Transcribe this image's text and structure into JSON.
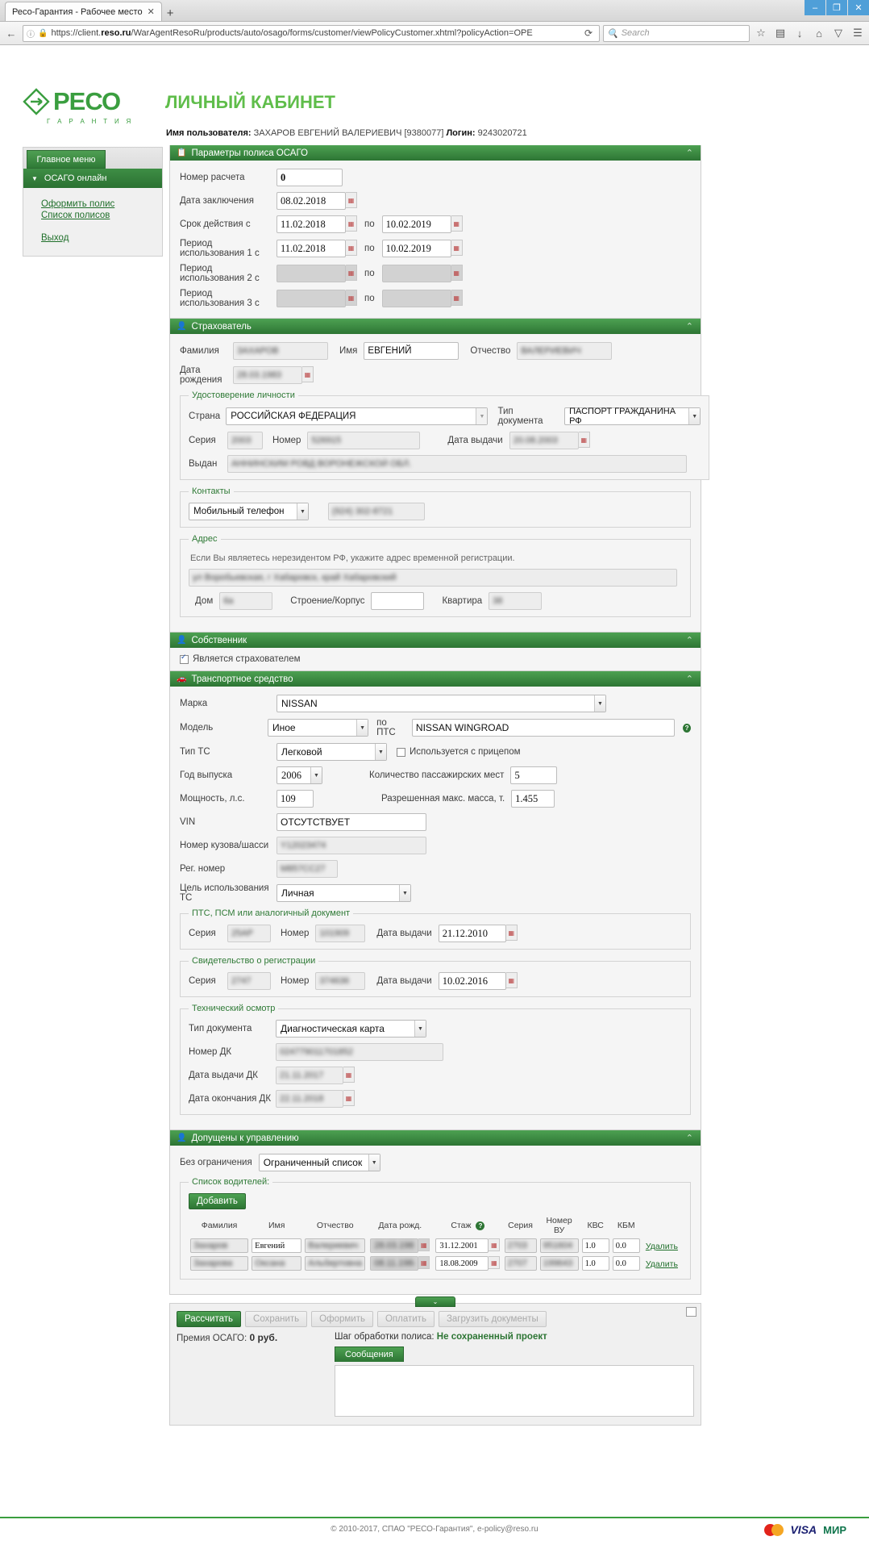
{
  "browser": {
    "tab_title": "Ресо-Гарантия - Рабочее место",
    "tab_close": "✕",
    "new_tab": "+",
    "window_minimize": "–",
    "window_maximize": "❐",
    "window_close": "✕",
    "url_prefix": "https://client.",
    "url_host": "reso.ru",
    "url_path": "/WarAgentResoRu/products/auto/osago/forms/customer/viewPolicyCustomer.xhtml?policyAction=OPE",
    "reload": "⟳",
    "search_placeholder": "Search",
    "back": "←",
    "forward": "→",
    "bookmark": "☆",
    "reader": "▤",
    "download": "↓",
    "home": "⌂",
    "shield": "▽",
    "menu": "☰"
  },
  "brand": {
    "word": "РЕСО",
    "tagline": "Г А Р А Н Т И Я"
  },
  "header": {
    "title": "ЛИЧНЫЙ КАБИНЕТ",
    "user_label": "Имя пользователя:",
    "user_name": "ЗАХАРОВ ЕВГЕНИЙ ВАЛЕРИЕВИЧ [9380077]",
    "login_label": "Логин:",
    "login_value": "9243020721"
  },
  "sidebar": {
    "main_menu_button": "Главное меню",
    "section_label": "ОСАГО онлайн",
    "links": [
      "Оформить полис",
      "Список полисов"
    ],
    "logout": "Выход"
  },
  "policy_params": {
    "title": "Параметры полиса ОСАГО",
    "calc_number_label": "Номер расчета",
    "calc_number_value": "0",
    "conclusion_date_label": "Дата заключения",
    "conclusion_date_value": "08.02.2018",
    "validity_label": "Срок действия с",
    "validity_from": "11.02.2018",
    "to_label": "по",
    "validity_to": "10.02.2019",
    "period1_label": "Период использования 1 с",
    "period1_from": "11.02.2018",
    "period1_to": "10.02.2019",
    "period2_label": "Период использования 2 с",
    "period2_from": "",
    "period2_to": "",
    "period3_label": "Период использования 3 с",
    "period3_from": "",
    "period3_to": ""
  },
  "insurer": {
    "title": "Страхователь",
    "surname_label": "Фамилия",
    "surname_value": "ЗАХАРОВ",
    "name_label": "Имя",
    "name_value": "ЕВГЕНИЙ",
    "patronymic_label": "Отчество",
    "patronymic_value": "ВАЛЕРИЕВИЧ",
    "birthdate_label": "Дата рождения",
    "birthdate_value": "28.03.1983",
    "id_doc": {
      "legend": "Удостоверение личности",
      "country_label": "Страна",
      "country_value": "РОССИЙСКАЯ ФЕДЕРАЦИЯ",
      "doctype_label": "Тип документа",
      "doctype_value": "ПАСПОРТ ГРАЖДАНИНА РФ",
      "series_label": "Серия",
      "series_value": "2003",
      "number_label": "Номер",
      "number_value": "526915",
      "issue_date_label": "Дата выдачи",
      "issue_date_value": "20.08.2003",
      "issued_by_label": "Выдан",
      "issued_by_value": "АННИНСКИМ РОВД ВОРОНЕЖСКОЙ ОБЛ."
    },
    "contacts": {
      "legend": "Контакты",
      "type_value": "Мобильный телефон",
      "phone_value": "(924) 302-8721"
    },
    "address": {
      "legend": "Адрес",
      "hint": "Если Вы являетесь нерезидентом РФ, укажите адрес временной регистрации.",
      "address_value": "ул Воробьевская, г Хабаровск, край Хабаровский",
      "house_label": "Дом",
      "house_value": "6а",
      "building_label": "Строение/Корпус",
      "building_value": "",
      "flat_label": "Квартира",
      "flat_value": "38"
    }
  },
  "owner": {
    "title": "Собственник",
    "same_as_insurer_label": "Является страхователем",
    "same_as_insurer_checked": true
  },
  "vehicle": {
    "title": "Транспортное средство",
    "brand_label": "Марка",
    "brand_value": "NISSAN",
    "model_label": "Модель",
    "model_value": "Иное",
    "pts_model_label": "по ПТС",
    "pts_model_value": "NISSAN WINGROAD",
    "type_label": "Тип ТС",
    "type_value": "Легковой",
    "trailer_label": "Используется с прицепом",
    "trailer_checked": false,
    "year_label": "Год выпуска",
    "year_value": "2006",
    "seats_label": "Количество пассажирских мест",
    "seats_value": "5",
    "power_label": "Мощность, л.с.",
    "power_value": "109",
    "max_mass_label": "Разрешенная макс. масса, т.",
    "max_mass_value": "1.455",
    "vin_label": "VIN",
    "vin_value": "ОТСУТСТВУЕТ",
    "body_label": "Номер кузова/шасси",
    "body_value": "Y12023474",
    "reg_label": "Рег. номер",
    "reg_value": "М857СС27",
    "purpose_label": "Цель использования ТС",
    "purpose_value": "Личная",
    "pts": {
      "legend": "ПТС, ПСМ или аналогичный документ",
      "series_label": "Серия",
      "series_value": "25АР",
      "number_label": "Номер",
      "number_value": "101909",
      "date_label": "Дата выдачи",
      "date_value": "21.12.2010"
    },
    "sts": {
      "legend": "Свидетельство о регистрации",
      "series_label": "Серия",
      "series_value": "2747",
      "number_label": "Номер",
      "number_value": "374636",
      "date_label": "Дата выдачи",
      "date_value": "10.02.2016"
    },
    "inspection": {
      "legend": "Технический осмотр",
      "doctype_label": "Тип документа",
      "doctype_value": "Диагностическая карта",
      "dk_number_label": "Номер ДК",
      "dk_number_value": "024779011701852",
      "dk_issue_label": "Дата выдачи ДК",
      "dk_issue_value": "21.11.2017",
      "dk_expire_label": "Дата окончания ДК",
      "dk_expire_value": "22.11.2018"
    }
  },
  "drivers": {
    "title": "Допущены к управлению",
    "restriction_label": "Без ограничения",
    "restriction_value": "Ограниченный список",
    "list_legend": "Список водителей:",
    "add_button": "Добавить",
    "columns": [
      "Фамилия",
      "Имя",
      "Отчество",
      "Дата рожд.",
      "Стаж",
      "Серия",
      "Номер ВУ",
      "КВС",
      "КБМ"
    ],
    "rows": [
      {
        "surname": "Захаров",
        "name": "Евгений",
        "patronymic": "Валериевич",
        "birthdate": "28.03.1983",
        "experience": "31.12.2001",
        "series": "2703",
        "license": "951604",
        "kvs": "1.0",
        "kbm": "0.0",
        "delete": "Удалить"
      },
      {
        "surname": "Захарова",
        "name": "Оксана",
        "patronymic": "Альбертовна",
        "birthdate": "08.11.1984",
        "experience": "18.08.2009",
        "series": "2707",
        "license": "199643",
        "kvs": "1.0",
        "kbm": "0.0",
        "delete": "Удалить"
      }
    ]
  },
  "actions": {
    "calculate": "Рассчитать",
    "save": "Сохранить",
    "issue": "Оформить",
    "pay": "Оплатить",
    "upload": "Загрузить документы",
    "premium_label": "Премия ОСАГО:",
    "premium_value": "0 руб.",
    "step_label": "Шаг обработки полиса:",
    "step_value": "Не сохраненный проект",
    "messages_tab": "Сообщения"
  },
  "footer": {
    "copyright": "© 2010-2017, СПАО \"РЕСО-Гарантия\", e-policy@reso.ru",
    "visa": "VISA",
    "mir": "МИР"
  }
}
